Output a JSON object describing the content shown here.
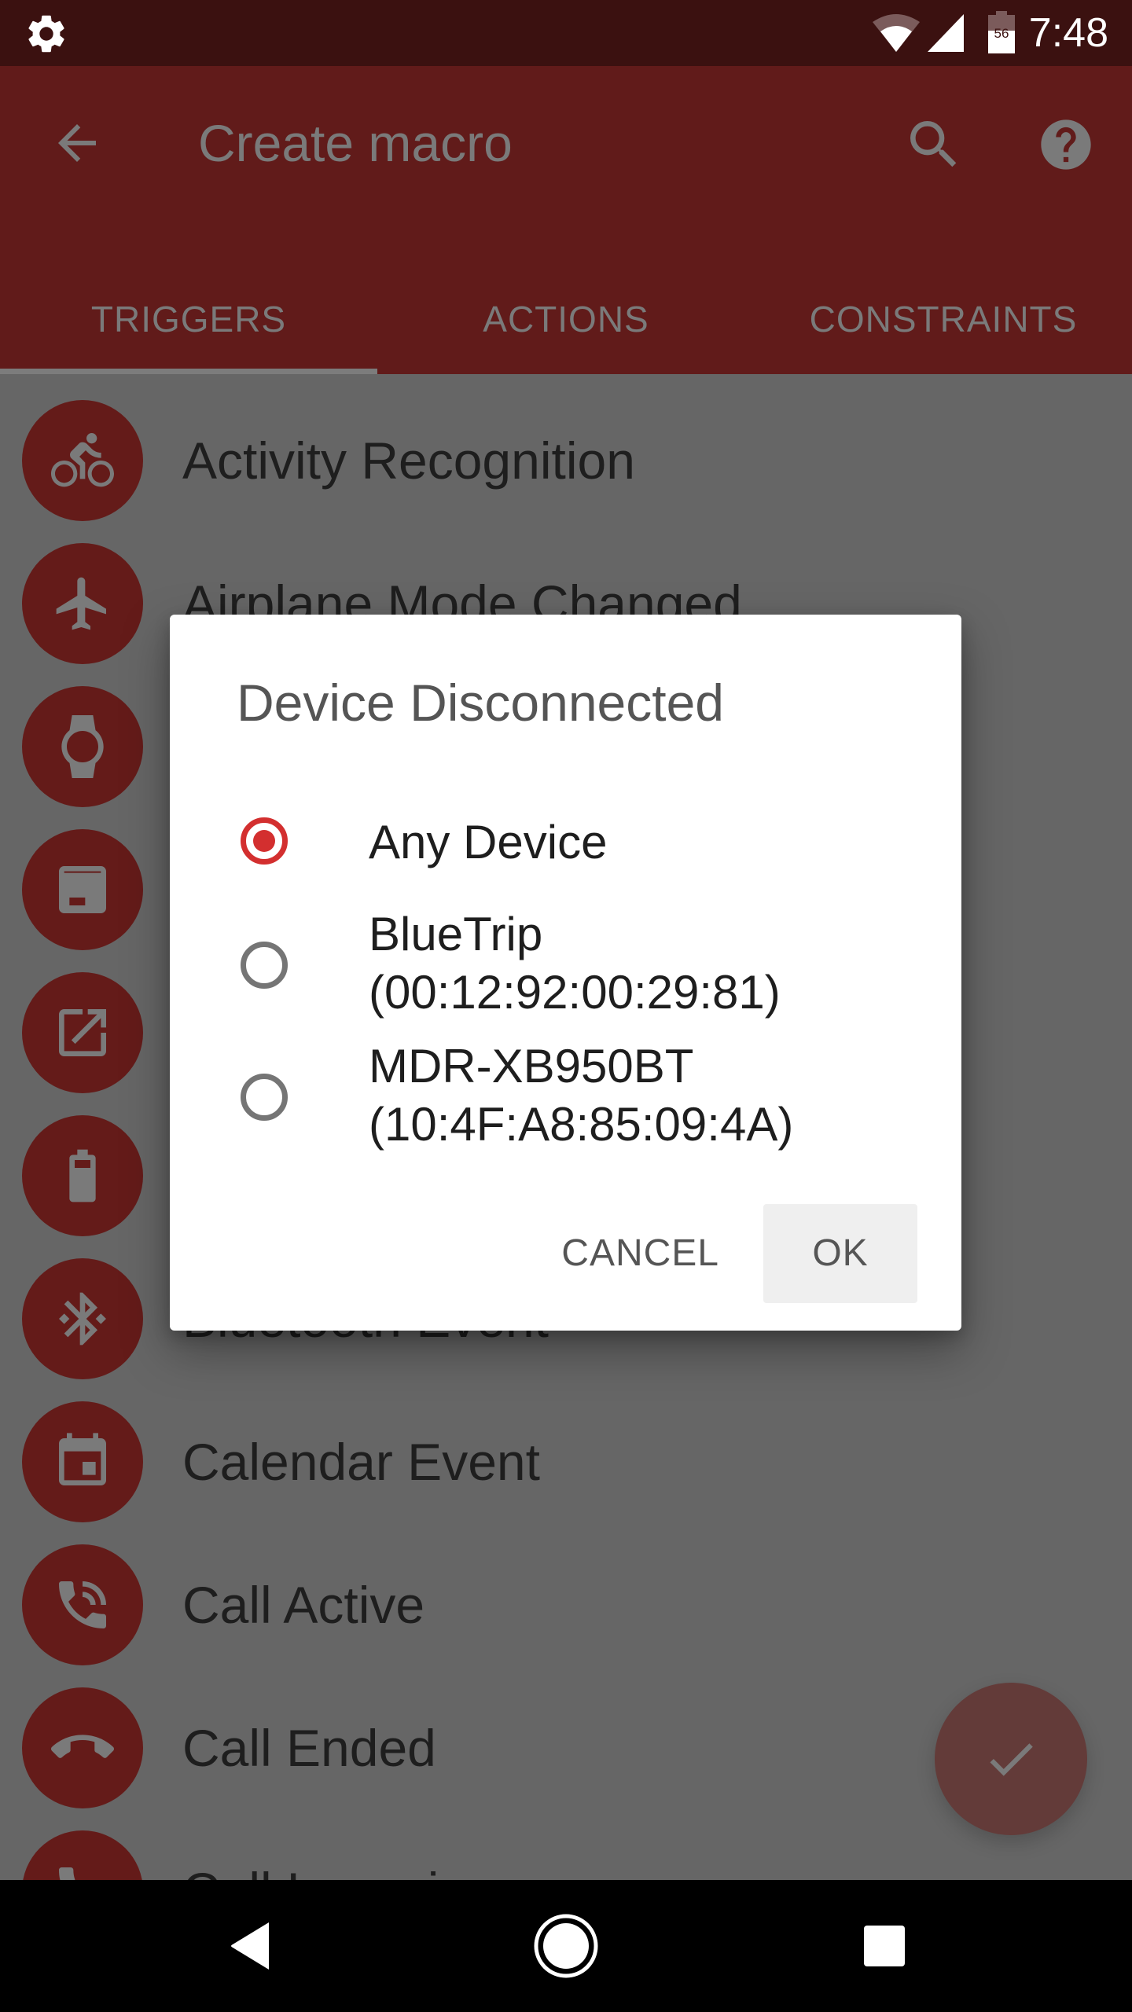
{
  "status_bar": {
    "time": "7:48",
    "battery_level": "56",
    "icons": [
      "settings-gear-icon",
      "wifi-icon",
      "cell-signal-icon",
      "battery-icon"
    ]
  },
  "toolbar": {
    "title": "Create macro",
    "back_icon": "arrow-back-icon",
    "search_icon": "search-icon",
    "help_icon": "help-icon"
  },
  "tabs": [
    {
      "label": "TRIGGERS",
      "selected": true
    },
    {
      "label": "ACTIONS",
      "selected": false
    },
    {
      "label": "CONSTRAINTS",
      "selected": false
    }
  ],
  "triggers": [
    {
      "label": "Activity Recognition",
      "icon": "bicycle-icon"
    },
    {
      "label": "Airplane Mode Changed",
      "icon": "airplane-icon"
    },
    {
      "label": "",
      "icon": "watch-icon"
    },
    {
      "label": "",
      "icon": "app-window-icon"
    },
    {
      "label": "",
      "icon": "open-in-new-icon"
    },
    {
      "label": "",
      "icon": "battery-icon"
    },
    {
      "label": "Bluetooth Event",
      "icon": "bluetooth-icon"
    },
    {
      "label": "Calendar Event",
      "icon": "calendar-icon"
    },
    {
      "label": "Call Active",
      "icon": "phone-in-talk-icon"
    },
    {
      "label": "Call Ended",
      "icon": "call-end-icon"
    },
    {
      "label": "Call Incoming",
      "icon": "phone-icon"
    }
  ],
  "fab": {
    "icon": "check-icon"
  },
  "dialog": {
    "title": "Device Disconnected",
    "options": [
      {
        "line1": "Any Device",
        "line2": "",
        "checked": true
      },
      {
        "line1": "BlueTrip",
        "line2": "(00:12:92:00:29:81)",
        "checked": false
      },
      {
        "line1": "MDR-XB950BT",
        "line2": "(10:4F:A8:85:09:4A)",
        "checked": false
      }
    ],
    "cancel_label": "CANCEL",
    "ok_label": "OK"
  },
  "nav_bar": {
    "back": "nav-back-icon",
    "home": "nav-home-icon",
    "recents": "nav-recents-icon"
  },
  "colors": {
    "status_bar": "#3b1110",
    "toolbar": "#611b1a",
    "icon_circle": "#641b19",
    "radio_accent": "#d32f2f",
    "scrim_background": "#666666"
  }
}
